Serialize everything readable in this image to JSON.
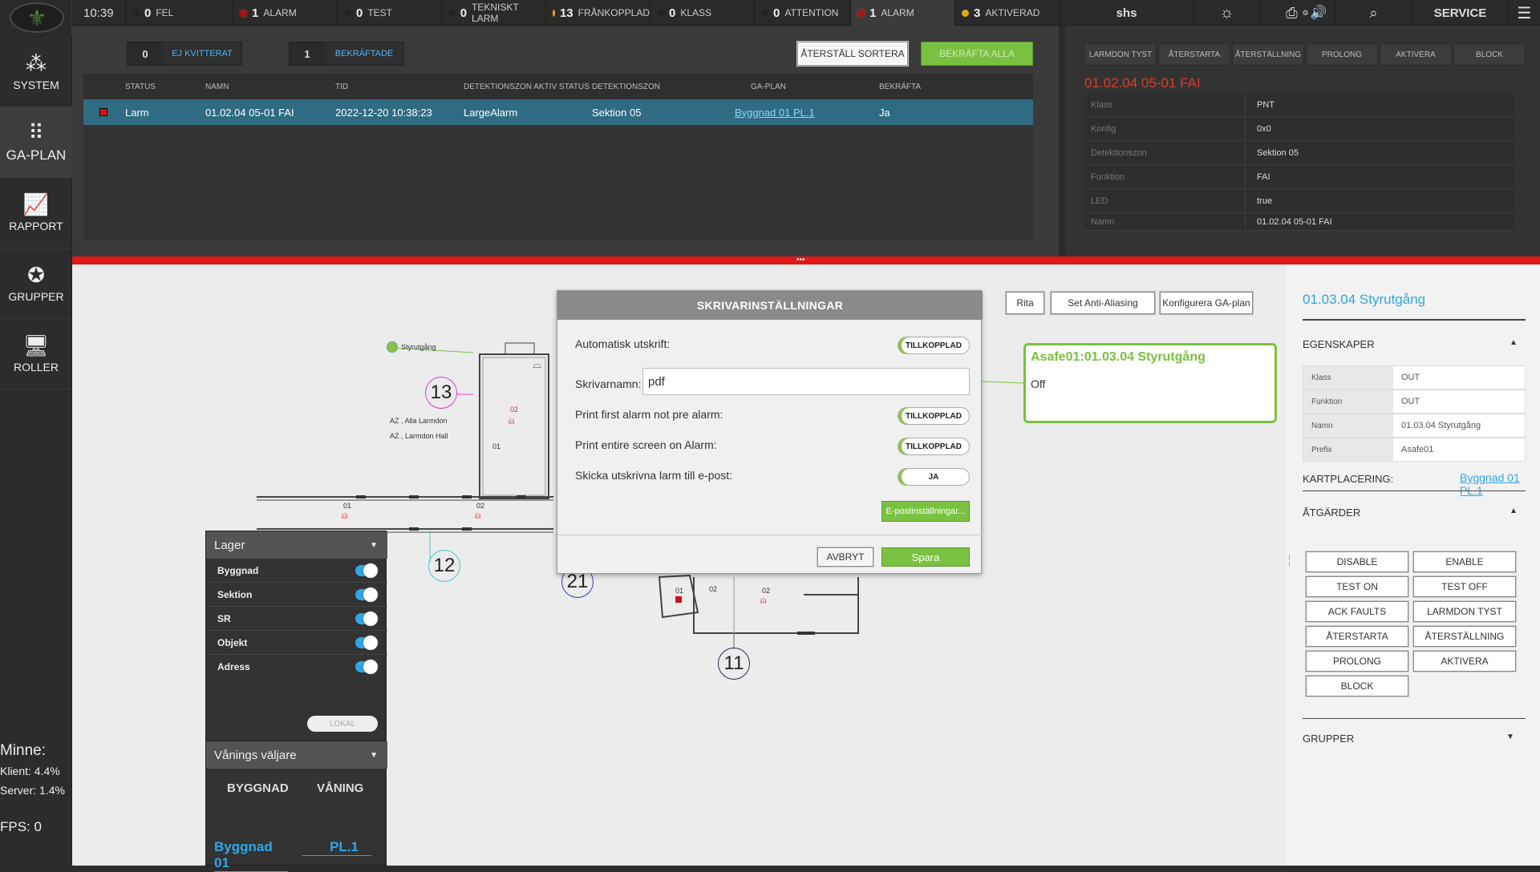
{
  "topbar": {
    "time": "10:39",
    "items": [
      {
        "count": "0",
        "label": "FEL"
      },
      {
        "count": "1",
        "label": "ALARM"
      },
      {
        "count": "0",
        "label": "TEST"
      },
      {
        "count": "0",
        "label": "TEKNISKT LARM"
      },
      {
        "count": "13",
        "label": "FRÅNKOPPLAD"
      },
      {
        "count": "0",
        "label": "KLASS"
      },
      {
        "count": "0",
        "label": "ATTENTION"
      },
      {
        "count": "1",
        "label": "ALARM"
      },
      {
        "count": "3",
        "label": "AKTIVERAD"
      }
    ],
    "user": "shs",
    "service": "SERVICE"
  },
  "sidebar": {
    "items": [
      {
        "label": "SYSTEM",
        "icon": "network-icon"
      },
      {
        "label": "GA-PLAN",
        "icon": "grid-dots-icon"
      },
      {
        "label": "RAPPORT",
        "icon": "chart-icon"
      },
      {
        "label": "GRUPPER",
        "icon": "group-icon"
      },
      {
        "label": "ROLLER",
        "icon": "monitor-icon"
      }
    ],
    "memory_label": "Minne:",
    "client": "Klient: 4.4%",
    "server": "Server: 1.4%",
    "fps": "FPS: 0"
  },
  "upper": {
    "ej_count": "0",
    "ej_label": "EJ KVITTERAT",
    "bek_count": "1",
    "bek_label": "BEKRÄFTADE",
    "reset_sort": "ÅTERSTÄLL SORTERA",
    "confirm_all": "BEKRÄFTA ALLA",
    "columns": [
      "STATUS",
      "NAMN",
      "TID",
      "DETEKTIONSZON AKTIV STATUS",
      "DETEKTIONSZON",
      "GA-PLAN",
      "BEKRÄFTA"
    ],
    "row": {
      "status": "Larm",
      "name": "01.02.04 05-01 FAI",
      "time": "2022-12-20 10:38:23",
      "zone_status": "LargeAlarm",
      "zone": "Sektion 05",
      "plan": "Byggnad 01 PL.1",
      "confirm": "Ja"
    }
  },
  "rupper": {
    "buttons": [
      "LARMDON TYST",
      "ÅTERSTARTA",
      "ÅTERSTÄLLNING",
      "PROLONG",
      "AKTIVERA",
      "BLOCK"
    ],
    "title": "01.02.04 05-01 FAI",
    "props": [
      {
        "k": "Klass",
        "v": "PNT"
      },
      {
        "k": "Konfig",
        "v": "0x0"
      },
      {
        "k": "Detektionszon",
        "v": "Sektion 05"
      },
      {
        "k": "Funktion",
        "v": "FAI"
      },
      {
        "k": "LED",
        "v": "true"
      },
      {
        "k": "Namn",
        "v": "01.02.04 05-01 FAI"
      }
    ]
  },
  "map": {
    "buttons": [
      "Rita",
      "Set Anti-Aliasing",
      "Konfigurera GA-plan"
    ],
    "labels": {
      "styrutgang": "Styrutgång",
      "alla": "AZ , Alla Larmdon",
      "hall": "AZ , Larmdon Hall",
      "n13": "13",
      "n12": "12",
      "n21": "21",
      "n11": "11",
      "s01a": "01",
      "s02a": "02",
      "s02b": "02",
      "s01b": "01",
      "s01c": "01",
      "s02c": "02",
      "s02d": "02",
      "s01d": "01"
    }
  },
  "popup": {
    "title": "SKRIVARINSTÄLLNINGAR",
    "auto_print": "Automatisk utskrift:",
    "auto_print_val": "TILLKOPPLAD",
    "printer_name": "Skrivarnamn:",
    "printer_value": "pdf",
    "first_alarm": "Print first alarm not pre alarm:",
    "first_alarm_val": "TILLKOPPLAD",
    "entire_screen": "Print entire screen on Alarm:",
    "entire_screen_val": "TILLKOPPLAD",
    "send_email": "Skicka utskrivna larm till e-post:",
    "send_email_val": "JA",
    "email_settings": "E-postinställningar...",
    "cancel": "AVBRYT",
    "save": "Spara"
  },
  "bubble": {
    "title": "Asafe01:01.03.04 Styrutgång",
    "value": "Off"
  },
  "lager": {
    "title": "Lager",
    "rows": [
      "Byggnad",
      "Sektion",
      "SR",
      "Objekt",
      "Adress"
    ],
    "lokal": "LOKAL"
  },
  "vaning": {
    "title": "Vånings väljare",
    "col_building": "BYGGNAD",
    "col_floor": "VÅNING",
    "building": "Byggnad 01",
    "floor": "PL.1"
  },
  "rprops": {
    "title": "01.03.04 Styrutgång",
    "egenskaper": "EGENSKAPER",
    "props": [
      {
        "k": "Klass",
        "v": "OUT"
      },
      {
        "k": "Funktion",
        "v": "OUT"
      },
      {
        "k": "Namn",
        "v": "01.03.04 Styrutgång"
      },
      {
        "k": "Prefix",
        "v": "Asafe01"
      }
    ],
    "kartplacering": "KARTPLACERING:",
    "kart_link": "Byggnad 01 PL.1",
    "atgarder": "ÅTGÄRDER",
    "actions": [
      "DISABLE",
      "ENABLE",
      "TEST ON",
      "TEST OFF",
      "ACK FAULTS",
      "LARMDON TYST",
      "ÅTERSTARTA",
      "ÅTERSTÄLLNING",
      "PROLONG",
      "AKTIVERA",
      "BLOCK"
    ],
    "grupper": "GRUPPER"
  },
  "colors": {
    "accent_green": "#7ac142",
    "alarm_red": "#e01818",
    "link_blue": "#2fa6e8"
  }
}
